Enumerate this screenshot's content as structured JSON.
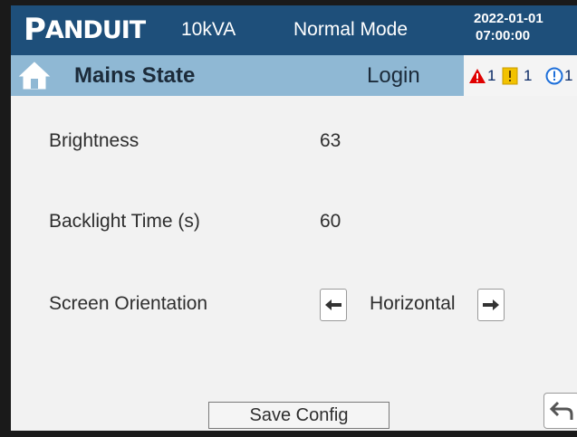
{
  "header": {
    "logo_first": "P",
    "logo_rest": "ANDUIT",
    "capacity": "10kVA",
    "mode": "Normal Mode",
    "date": "2022-01-01",
    "time": "07:00:00"
  },
  "statusbar": {
    "icon": "home-icon",
    "title": "Mains State",
    "login_label": "Login",
    "alarms": [
      {
        "icon": "critical-alarm-icon",
        "count": "1",
        "color": "#e00000"
      },
      {
        "icon": "warning-alarm-icon",
        "count": "1",
        "color": "#f2c200"
      },
      {
        "icon": "info-alarm-icon",
        "count": "1",
        "color": "#1e6fd9"
      }
    ]
  },
  "settings": {
    "brightness": {
      "label": "Brightness",
      "value": "63"
    },
    "backlight": {
      "label": "Backlight Time (s)",
      "value": "60"
    },
    "orientation": {
      "label": "Screen Orientation",
      "value": "Horizontal",
      "prev_icon": "arrow-left-icon",
      "next_icon": "arrow-right-icon"
    }
  },
  "footer": {
    "save_label": "Save Config",
    "back_icon": "return-icon"
  },
  "colors": {
    "header_bg": "#1e4f7a",
    "statusbar_bg": "#8fb8d4",
    "content_bg": "#f2f2f2"
  }
}
